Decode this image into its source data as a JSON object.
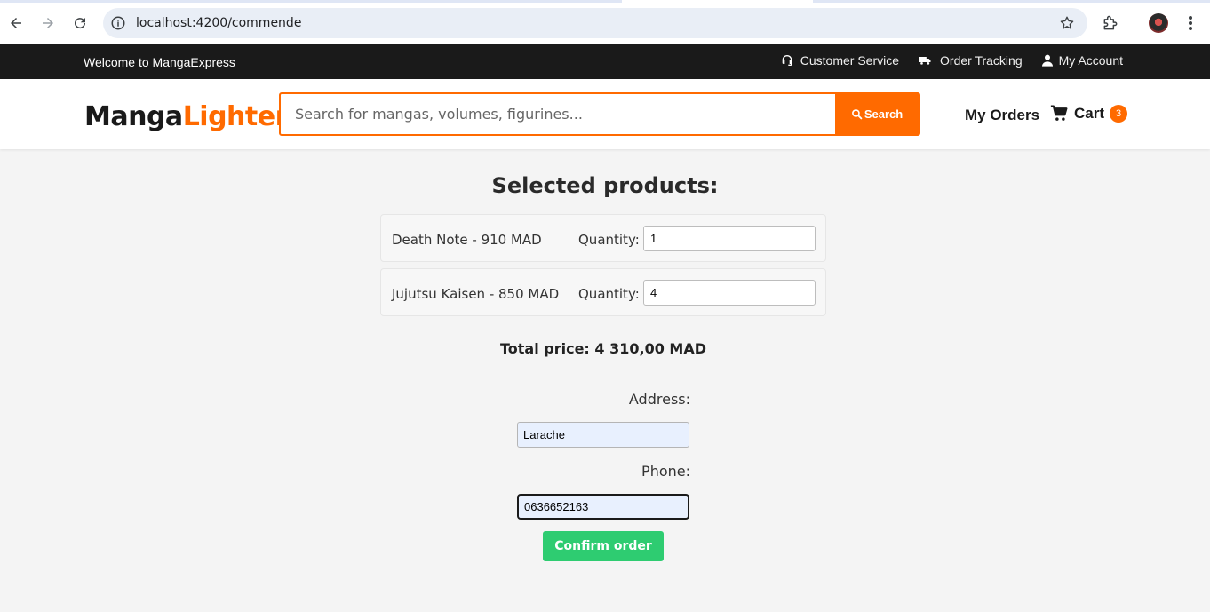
{
  "browser": {
    "url": "localhost:4200/commende"
  },
  "topbar": {
    "welcome": "Welcome to MangaExpress",
    "links": [
      {
        "label": "Customer Service",
        "icon": "headset-icon"
      },
      {
        "label": "Order Tracking",
        "icon": "truck-icon"
      },
      {
        "label": "My Account",
        "icon": "user-icon"
      }
    ]
  },
  "header": {
    "logo_part1": "Manga",
    "logo_part2": "Lighter",
    "search_placeholder": "Search for mangas, volumes, figurines...",
    "search_button": "Search",
    "my_orders": "My Orders",
    "cart_label": "Cart",
    "cart_count": "3"
  },
  "main": {
    "title": "Selected products:",
    "products": [
      {
        "name": "Death Note - 910 MAD",
        "quantity_label": "Quantity:",
        "quantity": "1"
      },
      {
        "name": "Jujutsu Kaisen - 850 MAD",
        "quantity_label": "Quantity:",
        "quantity": "4"
      }
    ],
    "total": "Total price: 4 310,00 MAD",
    "address_label": "Address:",
    "address_value": "Larache",
    "phone_label": "Phone:",
    "phone_value": "0636652163",
    "confirm_button": "Confirm order"
  },
  "colors": {
    "accent": "#ff6a00",
    "topbar_bg": "#1a1a1a",
    "confirm": "#2ecc71"
  }
}
